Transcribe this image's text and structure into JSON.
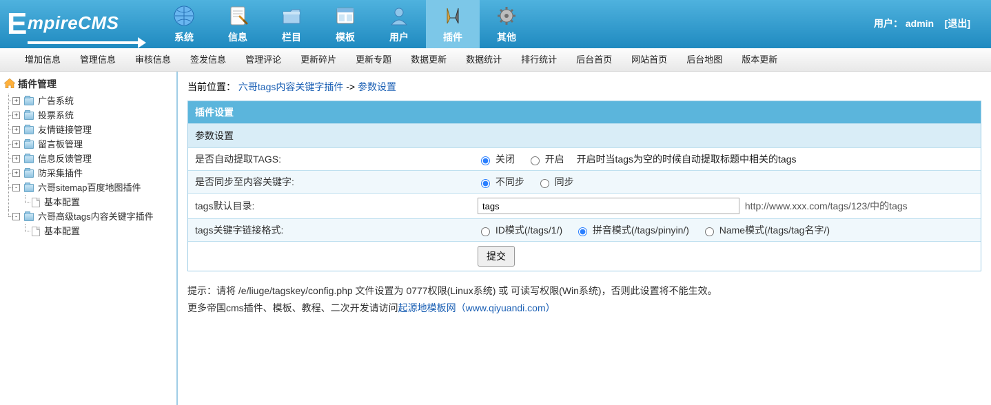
{
  "header": {
    "logo_small": "mpire",
    "logo_suffix": "CMS",
    "user_label": "用户：",
    "user_name": "admin",
    "logout_label": "[退出]"
  },
  "topnav": [
    {
      "key": "system",
      "label": "系统",
      "active": false
    },
    {
      "key": "info",
      "label": "信息",
      "active": false
    },
    {
      "key": "column",
      "label": "栏目",
      "active": false
    },
    {
      "key": "template",
      "label": "模板",
      "active": false
    },
    {
      "key": "user",
      "label": "用户",
      "active": false
    },
    {
      "key": "plugin",
      "label": "插件",
      "active": true
    },
    {
      "key": "other",
      "label": "其他",
      "active": false
    }
  ],
  "submenu": [
    "增加信息",
    "管理信息",
    "审核信息",
    "签发信息",
    "管理评论",
    "更新碎片",
    "更新专题",
    "数据更新",
    "数据统计",
    "排行统计",
    "后台首页",
    "网站首页",
    "后台地图",
    "版本更新"
  ],
  "tree_root": "插件管理",
  "tree": [
    {
      "label": "广告系统",
      "toggle": "+",
      "children": []
    },
    {
      "label": "投票系统",
      "toggle": "+",
      "children": []
    },
    {
      "label": "友情链接管理",
      "toggle": "+",
      "children": []
    },
    {
      "label": "留言板管理",
      "toggle": "+",
      "children": []
    },
    {
      "label": "信息反馈管理",
      "toggle": "+",
      "children": []
    },
    {
      "label": "防采集插件",
      "toggle": "+",
      "children": []
    },
    {
      "label": "六哥sitemap百度地图插件",
      "toggle": "-",
      "children": [
        "基本配置"
      ]
    },
    {
      "label": "六哥高级tags内容关键字插件",
      "toggle": "-",
      "children": [
        "基本配置"
      ]
    }
  ],
  "breadcrumb": {
    "prefix": "当前位置：",
    "link1": "六哥tags内容关键字插件",
    "sep": " -> ",
    "link2": "参数设置"
  },
  "panel": {
    "title": "插件设置",
    "sub": "参数设置",
    "rows": {
      "auto_tags_label": "是否自动提取TAGS:",
      "auto_tags_opt_off": "关闭",
      "auto_tags_opt_on": "开启",
      "auto_tags_help": "开启时当tags为空的时候自动提取标题中相关的tags",
      "sync_label": "是否同步至内容关键字:",
      "sync_opt_off": "不同步",
      "sync_opt_on": "同步",
      "dir_label": "tags默认目录:",
      "dir_value": "tags",
      "dir_hint": "http://www.xxx.com/tags/123/中的tags",
      "format_label": "tags关键字链接格式:",
      "format_id": "ID模式(/tags/1/)",
      "format_pinyin": "拼音模式(/tags/pinyin/)",
      "format_name": "Name模式(/tags/tag名字/)",
      "submit_label": "提交"
    }
  },
  "hints": {
    "line1": "提示：请将 /e/liuge/tagskey/config.php 文件设置为 0777权限(Linux系统) 或 可读写权限(Win系统)，否则此设置将不能生效。",
    "line2_a": "更多帝国cms插件、模板、教程、二次开发请访问",
    "line2_link": "起源地模板网（www.qiyuandi.com）"
  },
  "icons": {
    "globe": "globe-icon",
    "doc": "doc-icon",
    "folder": "folder-icon",
    "window": "window-icon",
    "person": "person-icon",
    "tools": "tools-icon",
    "gear": "gear-icon",
    "home": "home-icon"
  }
}
